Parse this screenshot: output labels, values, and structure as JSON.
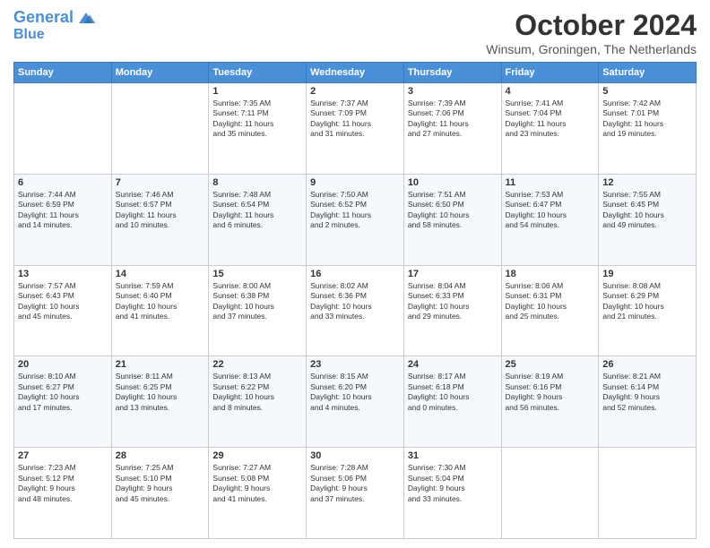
{
  "header": {
    "logo_line1": "General",
    "logo_line2": "Blue",
    "month_title": "October 2024",
    "location": "Winsum, Groningen, The Netherlands"
  },
  "days_of_week": [
    "Sunday",
    "Monday",
    "Tuesday",
    "Wednesday",
    "Thursday",
    "Friday",
    "Saturday"
  ],
  "weeks": [
    [
      {
        "day": "",
        "info": ""
      },
      {
        "day": "",
        "info": ""
      },
      {
        "day": "1",
        "info": "Sunrise: 7:35 AM\nSunset: 7:11 PM\nDaylight: 11 hours\nand 35 minutes."
      },
      {
        "day": "2",
        "info": "Sunrise: 7:37 AM\nSunset: 7:09 PM\nDaylight: 11 hours\nand 31 minutes."
      },
      {
        "day": "3",
        "info": "Sunrise: 7:39 AM\nSunset: 7:06 PM\nDaylight: 11 hours\nand 27 minutes."
      },
      {
        "day": "4",
        "info": "Sunrise: 7:41 AM\nSunset: 7:04 PM\nDaylight: 11 hours\nand 23 minutes."
      },
      {
        "day": "5",
        "info": "Sunrise: 7:42 AM\nSunset: 7:01 PM\nDaylight: 11 hours\nand 19 minutes."
      }
    ],
    [
      {
        "day": "6",
        "info": "Sunrise: 7:44 AM\nSunset: 6:59 PM\nDaylight: 11 hours\nand 14 minutes."
      },
      {
        "day": "7",
        "info": "Sunrise: 7:46 AM\nSunset: 6:57 PM\nDaylight: 11 hours\nand 10 minutes."
      },
      {
        "day": "8",
        "info": "Sunrise: 7:48 AM\nSunset: 6:54 PM\nDaylight: 11 hours\nand 6 minutes."
      },
      {
        "day": "9",
        "info": "Sunrise: 7:50 AM\nSunset: 6:52 PM\nDaylight: 11 hours\nand 2 minutes."
      },
      {
        "day": "10",
        "info": "Sunrise: 7:51 AM\nSunset: 6:50 PM\nDaylight: 10 hours\nand 58 minutes."
      },
      {
        "day": "11",
        "info": "Sunrise: 7:53 AM\nSunset: 6:47 PM\nDaylight: 10 hours\nand 54 minutes."
      },
      {
        "day": "12",
        "info": "Sunrise: 7:55 AM\nSunset: 6:45 PM\nDaylight: 10 hours\nand 49 minutes."
      }
    ],
    [
      {
        "day": "13",
        "info": "Sunrise: 7:57 AM\nSunset: 6:43 PM\nDaylight: 10 hours\nand 45 minutes."
      },
      {
        "day": "14",
        "info": "Sunrise: 7:59 AM\nSunset: 6:40 PM\nDaylight: 10 hours\nand 41 minutes."
      },
      {
        "day": "15",
        "info": "Sunrise: 8:00 AM\nSunset: 6:38 PM\nDaylight: 10 hours\nand 37 minutes."
      },
      {
        "day": "16",
        "info": "Sunrise: 8:02 AM\nSunset: 6:36 PM\nDaylight: 10 hours\nand 33 minutes."
      },
      {
        "day": "17",
        "info": "Sunrise: 8:04 AM\nSunset: 6:33 PM\nDaylight: 10 hours\nand 29 minutes."
      },
      {
        "day": "18",
        "info": "Sunrise: 8:06 AM\nSunset: 6:31 PM\nDaylight: 10 hours\nand 25 minutes."
      },
      {
        "day": "19",
        "info": "Sunrise: 8:08 AM\nSunset: 6:29 PM\nDaylight: 10 hours\nand 21 minutes."
      }
    ],
    [
      {
        "day": "20",
        "info": "Sunrise: 8:10 AM\nSunset: 6:27 PM\nDaylight: 10 hours\nand 17 minutes."
      },
      {
        "day": "21",
        "info": "Sunrise: 8:11 AM\nSunset: 6:25 PM\nDaylight: 10 hours\nand 13 minutes."
      },
      {
        "day": "22",
        "info": "Sunrise: 8:13 AM\nSunset: 6:22 PM\nDaylight: 10 hours\nand 8 minutes."
      },
      {
        "day": "23",
        "info": "Sunrise: 8:15 AM\nSunset: 6:20 PM\nDaylight: 10 hours\nand 4 minutes."
      },
      {
        "day": "24",
        "info": "Sunrise: 8:17 AM\nSunset: 6:18 PM\nDaylight: 10 hours\nand 0 minutes."
      },
      {
        "day": "25",
        "info": "Sunrise: 8:19 AM\nSunset: 6:16 PM\nDaylight: 9 hours\nand 56 minutes."
      },
      {
        "day": "26",
        "info": "Sunrise: 8:21 AM\nSunset: 6:14 PM\nDaylight: 9 hours\nand 52 minutes."
      }
    ],
    [
      {
        "day": "27",
        "info": "Sunrise: 7:23 AM\nSunset: 5:12 PM\nDaylight: 9 hours\nand 48 minutes."
      },
      {
        "day": "28",
        "info": "Sunrise: 7:25 AM\nSunset: 5:10 PM\nDaylight: 9 hours\nand 45 minutes."
      },
      {
        "day": "29",
        "info": "Sunrise: 7:27 AM\nSunset: 5:08 PM\nDaylight: 9 hours\nand 41 minutes."
      },
      {
        "day": "30",
        "info": "Sunrise: 7:28 AM\nSunset: 5:06 PM\nDaylight: 9 hours\nand 37 minutes."
      },
      {
        "day": "31",
        "info": "Sunrise: 7:30 AM\nSunset: 5:04 PM\nDaylight: 9 hours\nand 33 minutes."
      },
      {
        "day": "",
        "info": ""
      },
      {
        "day": "",
        "info": ""
      }
    ]
  ]
}
